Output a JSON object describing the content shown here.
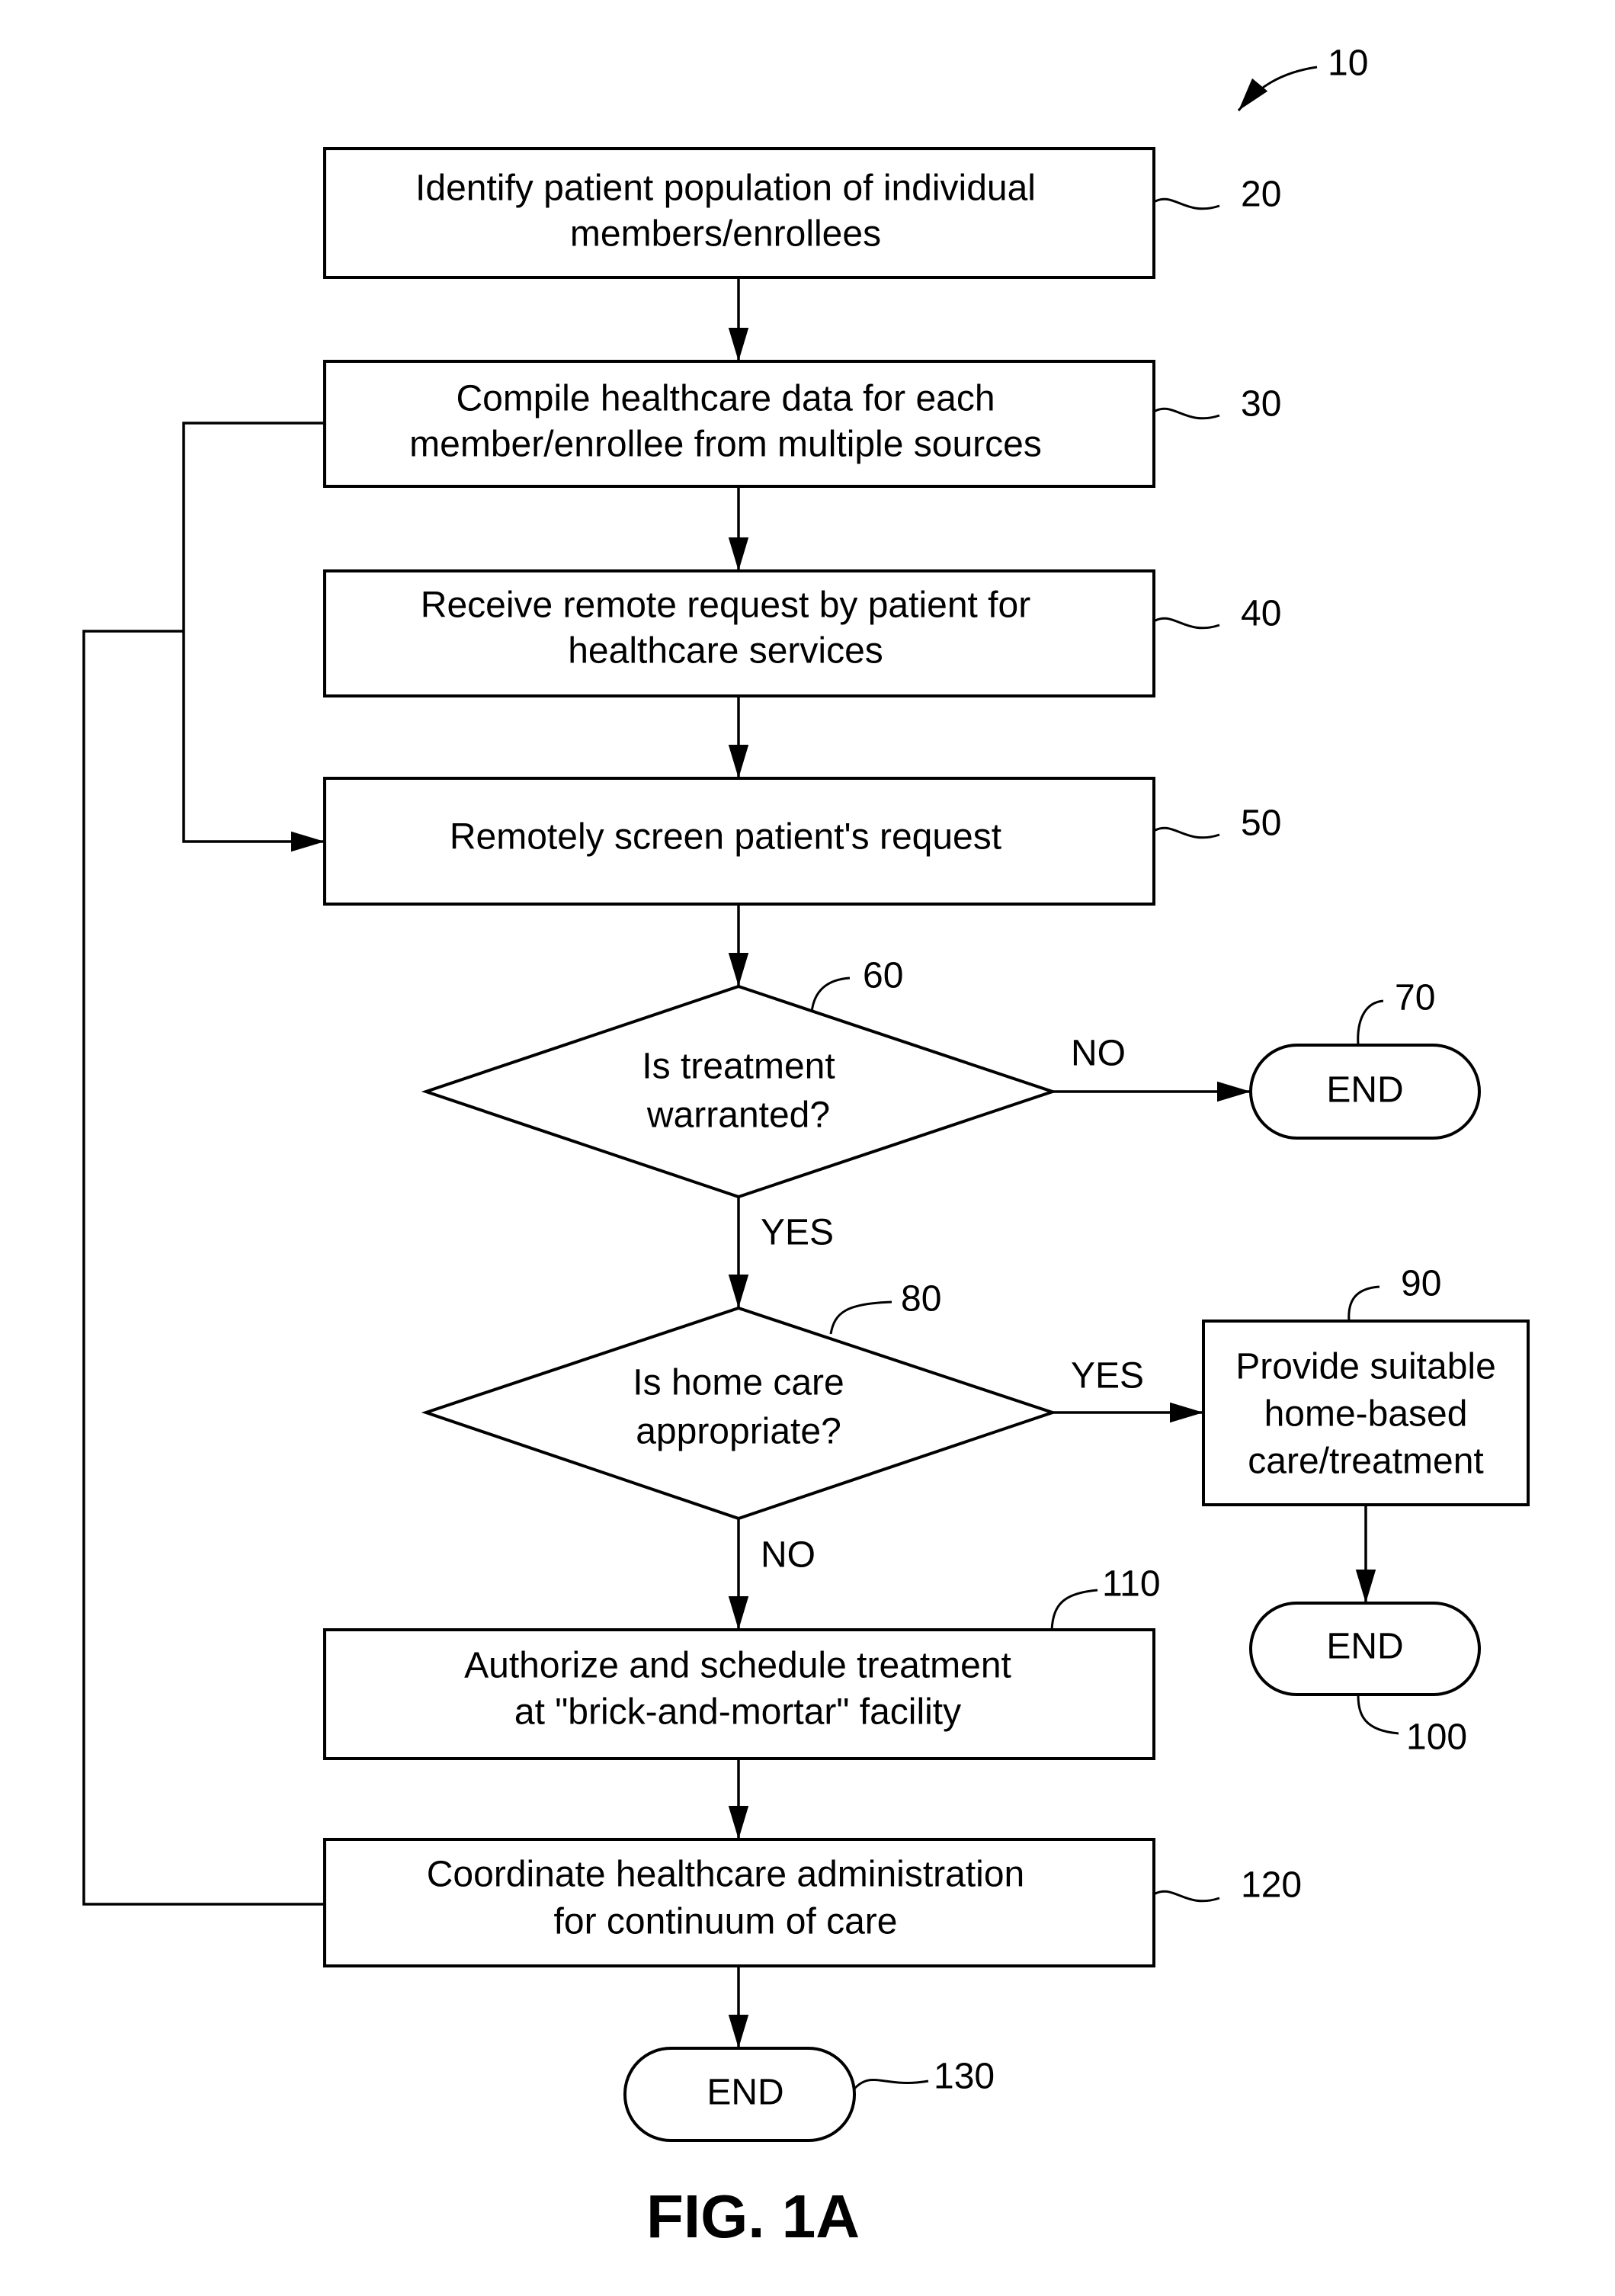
{
  "figure": {
    "caption": "FIG. 1A",
    "reference": "10"
  },
  "nodes": {
    "n20": {
      "ref": "20",
      "lines": [
        "Identify patient population of individual",
        "members/enrollees"
      ]
    },
    "n30": {
      "ref": "30",
      "lines": [
        "Compile healthcare data for each",
        "member/enrollee from multiple sources"
      ]
    },
    "n40": {
      "ref": "40",
      "lines": [
        "Receive remote request by patient for",
        "healthcare services"
      ]
    },
    "n50": {
      "ref": "50",
      "lines": [
        "Remotely screen patient's request"
      ]
    },
    "n60": {
      "ref": "60",
      "lines": [
        "Is treatment",
        "warranted?"
      ]
    },
    "n70": {
      "ref": "70",
      "lines": [
        "END"
      ]
    },
    "n80": {
      "ref": "80",
      "lines": [
        "Is home care",
        "appropriate?"
      ]
    },
    "n90": {
      "ref": "90",
      "lines": [
        "Provide suitable",
        "home-based",
        "care/treatment"
      ]
    },
    "n100": {
      "ref": "100",
      "lines": [
        "END"
      ]
    },
    "n110": {
      "ref": "110",
      "lines": [
        "Authorize and schedule treatment",
        "at \"brick-and-mortar\" facility"
      ]
    },
    "n120": {
      "ref": "120",
      "lines": [
        "Coordinate healthcare administration",
        "for continuum of care"
      ]
    },
    "n130": {
      "ref": "130",
      "lines": [
        "END"
      ]
    }
  },
  "edges": {
    "n60_no": "NO",
    "n60_yes": "YES",
    "n80_yes": "YES",
    "n80_no": "NO"
  }
}
